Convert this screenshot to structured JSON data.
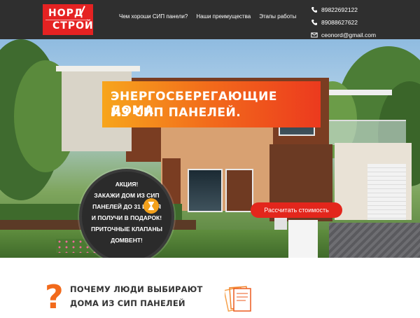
{
  "header": {
    "logo": {
      "line1": "НОРД",
      "line2": "СТРОЙ"
    },
    "nav": [
      {
        "label": "Чем хороши СИП панели?"
      },
      {
        "label": "Наши преимущества"
      },
      {
        "label": "Этапы работы"
      }
    ],
    "contacts": [
      {
        "icon": "phone-icon",
        "value": "89822692122"
      },
      {
        "icon": "phone-icon",
        "value": "89088627622"
      },
      {
        "icon": "email-icon",
        "value": "ceonord@gmail.com"
      }
    ]
  },
  "hero": {
    "title_line1": "ЭНЕРГОСБЕРЕГАЮЩИЕ ДОМА",
    "title_line2": "ИЗ СИП ПАНЕЛЕЙ.",
    "promo_lines": [
      "АКЦИЯ!",
      "ЗАКАЖИ ДОМ ИЗ СИП",
      "ПАНЕЛЕЙ ДО 31 ИЮЛЯ",
      "И ПОЛУЧИ В ПОДАРОК!",
      "ПРИТОЧНЫЕ КЛАПАНЫ",
      "ДОМВЕНТ!"
    ],
    "cta_label": "Рассчитать стоимость"
  },
  "why": {
    "line1": "ПОЧЕМУ ЛЮДИ ВЫБИРАЮТ",
    "line2": "ДОМА ИЗ СИП ПАНЕЛЕЙ",
    "qmark": "?"
  },
  "colors": {
    "header_bg": "#2f2f2f",
    "logo_red": "#e52222",
    "accent_orange": "#f26a1b",
    "cta_red": "#e3261c"
  }
}
